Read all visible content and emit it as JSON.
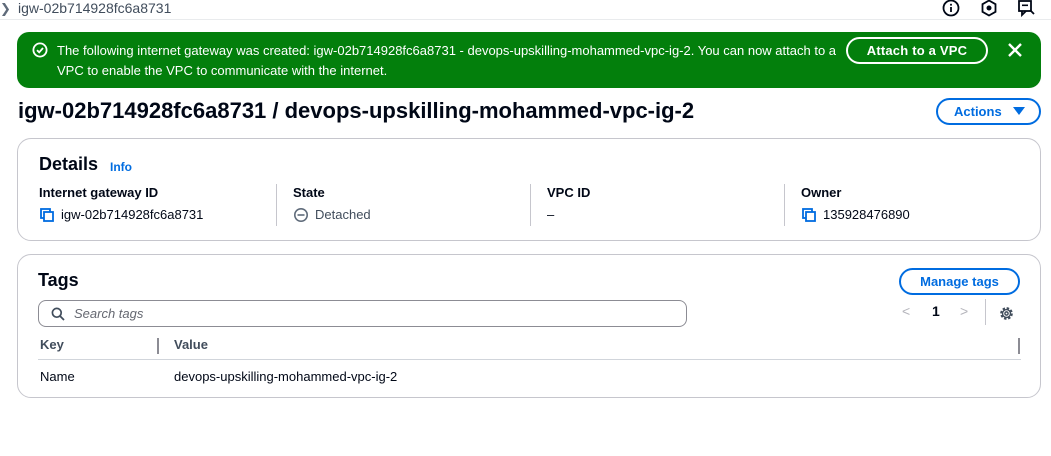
{
  "topbar": {
    "breadcrumb": "igw-02b714928fc6a8731",
    "icons": [
      "chevron-right-icon",
      "info-icon",
      "security-icon",
      "feedback-icon"
    ]
  },
  "flash": {
    "message": "The following internet gateway was created: igw-02b714928fc6a8731 - devops-upskilling-mohammed-vpc-ig-2. You can now attach to a VPC to enable the VPC to communicate with the internet.",
    "action_label": "Attach to a VPC",
    "color": "#037f0c",
    "icons": [
      "success-icon",
      "close-icon"
    ]
  },
  "header": {
    "title": "igw-02b714928fc6a8731 / devops-upskilling-mohammed-vpc-ig-2",
    "actions_label": "Actions"
  },
  "details": {
    "title": "Details",
    "info_label": "Info",
    "fields": [
      {
        "label": "Internet gateway ID",
        "value": "igw-02b714928fc6a8731"
      },
      {
        "label": "State",
        "value": "Detached"
      },
      {
        "label": "VPC ID",
        "value": "–"
      },
      {
        "label": "Owner",
        "value": "135928476890"
      }
    ]
  },
  "tags": {
    "title": "Tags",
    "manage_label": "Manage tags",
    "search_placeholder": "Search tags",
    "pagination": {
      "prev": "<",
      "page": "1",
      "next": ">"
    },
    "columns": [
      "Key",
      "Value"
    ],
    "rows": [
      {
        "key": "Name",
        "value": "devops-upskilling-mohammed-vpc-ig-2"
      }
    ]
  },
  "colors": {
    "link": "#006ce0",
    "success": "#037f0c",
    "border": "#c6c6cd"
  }
}
